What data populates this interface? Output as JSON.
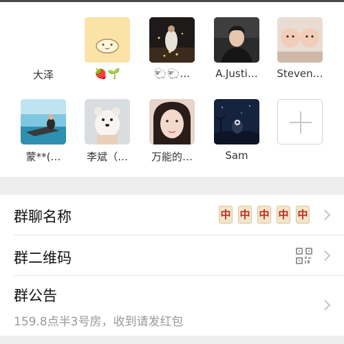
{
  "members": [
    {
      "name": "大泽",
      "avatar": "none"
    },
    {
      "name": "🍓🌱",
      "avatar": "yellow-cartoon"
    },
    {
      "name": "🐑🐑…",
      "avatar": "couple-night"
    },
    {
      "name": "A.Justi…",
      "avatar": "man-portrait"
    },
    {
      "name": "Steven…",
      "avatar": "twin-babies"
    },
    {
      "name": "蒙**(…",
      "avatar": "beach-lounge"
    },
    {
      "name": "李斌（…",
      "avatar": "white-puppy"
    },
    {
      "name": "万能的…",
      "avatar": "woman-selfie"
    },
    {
      "name": "Sam",
      "avatar": "cartoon-night"
    }
  ],
  "add_member": {
    "icon": "plus-icon"
  },
  "settings": {
    "group_name": {
      "label": "群聊名称",
      "value": "🀄🀄🀄🀄🀄",
      "tile_char": "中"
    },
    "qr_code": {
      "label": "群二维码",
      "icon": "qr-code-icon"
    },
    "notice": {
      "label": "群公告",
      "text": "159.8点半3号房，收到请发红包"
    }
  },
  "colors": {
    "background": "#ededed",
    "card": "#ffffff",
    "secondary_text": "#999999",
    "tile_red": "#c4242a"
  }
}
